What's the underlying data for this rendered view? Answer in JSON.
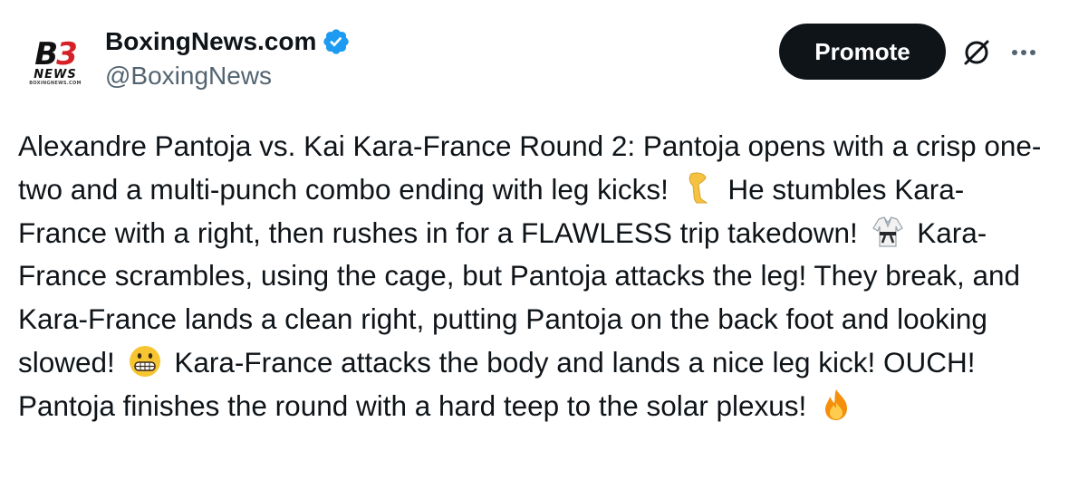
{
  "header": {
    "avatar_logo": {
      "mark": "B3",
      "word": "NEWS",
      "url": "BOXINGNEWS.COM"
    },
    "display_name": "BoxingNews.com",
    "handle": "@BoxingNews",
    "verified_icon": "verified-badge-icon",
    "promote_label": "Promote",
    "grok_icon": "grok-icon",
    "more_icon": "more-icon"
  },
  "tweet": {
    "segments": [
      "Alexandre Pantoja vs. Kai Kara-France Round 2: Pantoja opens with a crisp one-two and a multi-punch combo ending with leg kicks!",
      "He stumbles Kara-France with a right, then rushes in for a FLAWLESS trip takedown!",
      "Kara-France scrambles, using the cage, but Pantoja attacks the leg! They break, and Kara-France lands a clean right, putting Pantoja on the back foot and looking slowed!",
      "Kara-France attacks the body and lands a nice leg kick! OUCH! Pantoja finishes the round with a hard teep to the solar plexus!"
    ],
    "emojis": [
      "leg-emoji",
      "martial-arts-uniform-emoji",
      "grimacing-face-emoji",
      "fire-emoji"
    ]
  },
  "colors": {
    "text": "#0f1419",
    "secondary": "#536471",
    "verified": "#1d9bf0",
    "promote_bg": "#0f1419",
    "logo_red": "#d62027"
  }
}
